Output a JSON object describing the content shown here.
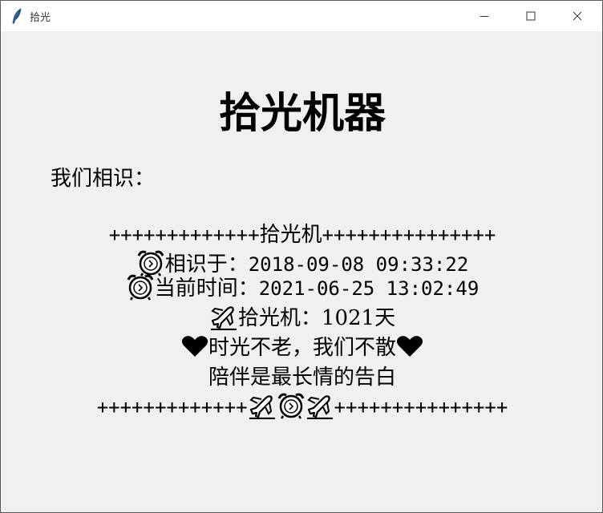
{
  "window": {
    "title": "拾光",
    "minimize_icon": "minimize-icon",
    "maximize_icon": "maximize-icon",
    "close_icon": "close-icon"
  },
  "main": {
    "heading": "拾光机器",
    "subtitle": "我们相识：",
    "top_rule_left": "+++++++++++++",
    "top_rule_label": "拾光机",
    "top_rule_right": "+++++++++++++++",
    "met_label": "相识于：",
    "met_date": "2018-09-08 09:33:22",
    "now_label": "当前时间：",
    "now_date": "2021-06-25 13:02:49",
    "days_label": "拾光机：",
    "days_value": "1021天",
    "motto": "时光不老，我们不散",
    "tagline": "陪伴是最长情的告白",
    "bottom_rule_left": "+++++++++++++",
    "bottom_rule_right": "+++++++++++++++"
  }
}
